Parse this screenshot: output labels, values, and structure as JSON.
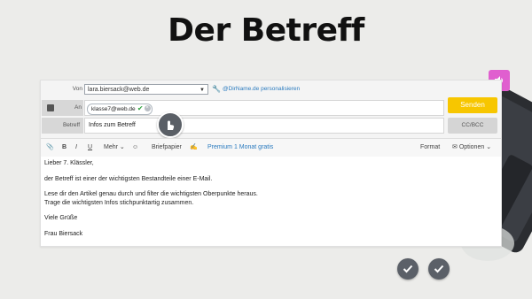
{
  "page": {
    "title": "Der Betreff"
  },
  "audio": {
    "icon": "speaker-icon",
    "color": "#e05fcf"
  },
  "compose": {
    "from": {
      "label": "Von",
      "value": "lara.biersack@web.de",
      "personalize_link": "@DirName.de personalisieren"
    },
    "to": {
      "label": "An",
      "recipient": "klasse7@web.de"
    },
    "subject": {
      "label": "Betreff",
      "value": "Infos zum Betreff"
    },
    "send_label": "Senden",
    "cc_label": "CC/BCC",
    "accent_color": "#f7c600"
  },
  "toolbar": {
    "bold": "B",
    "italic": "I",
    "underline": "U",
    "more": "Mehr",
    "stationery": "Briefpapier",
    "premium": "Premium 1 Monat gratis",
    "format": "Format",
    "options": "Optionen"
  },
  "body": {
    "lines": [
      "Lieber 7. Klässler,",
      "der Betreff ist einer der wichtigsten Bestandteile einer E-Mail.",
      "Lese dir den Artikel genau durch und filter die wichtigsten Oberpunkte heraus.",
      "Trage die wichtigsten Infos stichpunktartig zusammen.",
      "Viele Grüße",
      "Frau Biersack"
    ]
  },
  "actions": {
    "check_icon": "check-icon"
  }
}
